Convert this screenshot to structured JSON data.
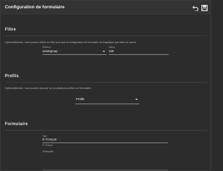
{
  "header": {
    "title": "Configuration de formulaire"
  },
  "icons": {
    "undo": "undo-icon",
    "save": "save-icon"
  },
  "filtre": {
    "title": "Filtre",
    "description": "Optionnellement, vous pouvez définir un filtre pour que la configuration de formulaire ne s'applique que dans ce cas là.",
    "element_label": "Elément",
    "element_value": "assetgroup",
    "valeur_label": "Valeur",
    "valeur_value": "100"
  },
  "profils": {
    "title": "Profils",
    "description": "Optionnellement, vous pouvez associer un ou plusieurs profils à ce formulaire.",
    "select_placeholder": "Profils"
  },
  "formulaire": {
    "title": "Formulaire",
    "titre_label": "Titre",
    "titre_value": "E-Tronçon",
    "titre_hint": "E-Tronçon",
    "description_label": "Description"
  }
}
